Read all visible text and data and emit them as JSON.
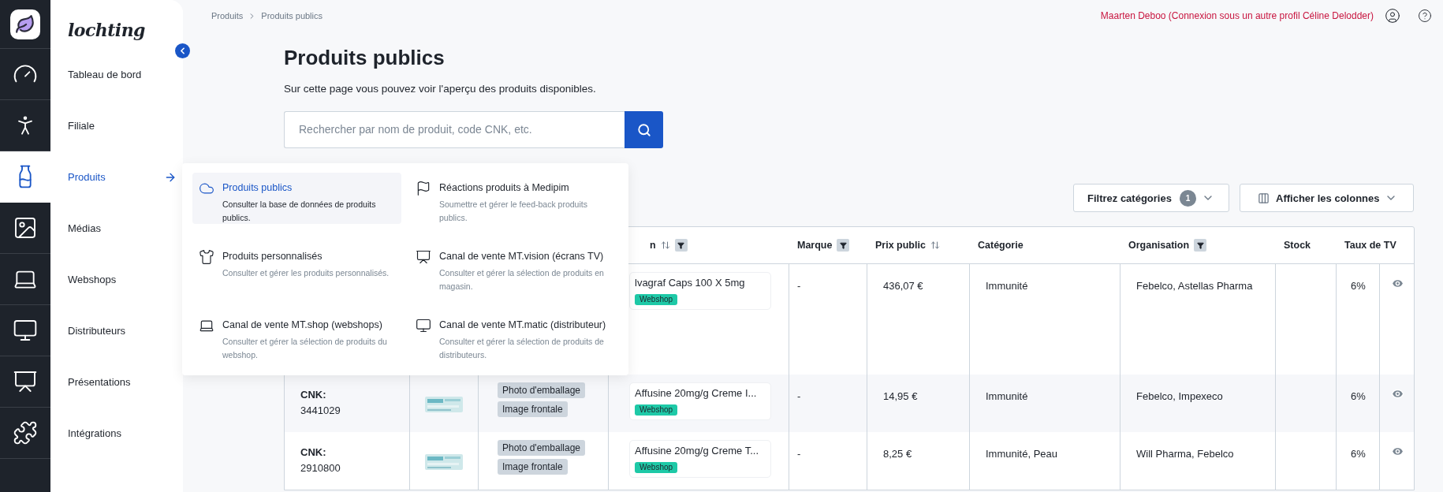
{
  "logo": {
    "text": "lochting"
  },
  "nav": [
    {
      "label": "Tableau de bord",
      "selected": false
    },
    {
      "label": "Filiale",
      "selected": false
    },
    {
      "label": "Produits",
      "selected": true
    },
    {
      "label": "Médias",
      "selected": false
    },
    {
      "label": "Webshops",
      "selected": false
    },
    {
      "label": "Distributeurs",
      "selected": false
    },
    {
      "label": "Présentations",
      "selected": false
    },
    {
      "label": "Intégrations",
      "selected": false
    }
  ],
  "breadcrumb": [
    "Produits",
    "Produits publics"
  ],
  "user": {
    "text": "Maarten Deboo (Connexion sous un autre profil Céline Delodder)"
  },
  "page": {
    "title": "Produits publics",
    "subtitle": "Sur cette page vous pouvez voir l'aperçu des produits disponibles.",
    "search": {
      "placeholder": "Rechercher par nom de produit, code CNK, etc."
    }
  },
  "filters": [
    {
      "kind": "count",
      "label": "Filtrez catégories",
      "count": "1"
    },
    {
      "kind": "columns",
      "label": "Afficher les colonnes"
    }
  ],
  "table": {
    "columns": [
      {
        "label": "n",
        "sortable": true,
        "filter": true
      },
      {
        "label": "Marque",
        "sortable": false,
        "filter": true
      },
      {
        "label": "Prix public",
        "sortable": true,
        "filter": false
      },
      {
        "label": "Catégorie",
        "sortable": false,
        "filter": false
      },
      {
        "label": "Organisation",
        "sortable": false,
        "filter": true
      },
      {
        "label": "Stock",
        "sortable": false,
        "filter": false
      },
      {
        "label": "Taux de TV",
        "sortable": false,
        "filter": false
      }
    ],
    "rows": [
      {
        "name": "lvagraf Caps 100 X 5mg",
        "badge": "Webshop",
        "brand": "-",
        "price": "436,07 €",
        "category": "Immunité",
        "organisation": "Febelco, Astellas Pharma",
        "vat": "6%"
      },
      {
        "cnk_label": "CNK:",
        "cnk": "3441029",
        "media": [
          "Photo d'emballage",
          "Image frontale"
        ],
        "name": "Affusine 20mg/g Creme I...",
        "badge": "Webshop",
        "brand": "-",
        "price": "14,95 €",
        "category": "Immunité",
        "organisation": "Febelco, Impexeco",
        "vat": "6%"
      },
      {
        "cnk_label": "CNK:",
        "cnk": "2910800",
        "media": [
          "Photo d'emballage",
          "Image frontale"
        ],
        "name": "Affusine 20mg/g Creme T...",
        "badge": "Webshop",
        "brand": "-",
        "price": "8,25 €",
        "category": "Immunité, Peau",
        "organisation": "Will Pharma, Febelco",
        "vat": "6%"
      }
    ]
  },
  "menu": [
    {
      "title": "Produits publics",
      "description": "Consulter la base de données de produits publics.",
      "selected": true
    },
    {
      "title": "Réactions produits à Medipim",
      "description": "Soumettre et gérer le feed-back produits publics.",
      "selected": false
    },
    {
      "title": "Produits personnalisés",
      "description": "Consulter et gérer les produits personnalisés.",
      "selected": false
    },
    {
      "title": "Canal de vente MT.vision (écrans TV)",
      "description": "Consulter et gérer la sélection de produits en magasin.",
      "selected": false
    },
    {
      "title": "Canal de vente MT.shop (webshops)",
      "description": "Consulter et gérer la sélection de produits du webshop.",
      "selected": false
    },
    {
      "title": "Canal de vente MT.matic (distributeur)",
      "description": "Consulter et gérer la sélection de produits de distributeurs.",
      "selected": false
    }
  ]
}
